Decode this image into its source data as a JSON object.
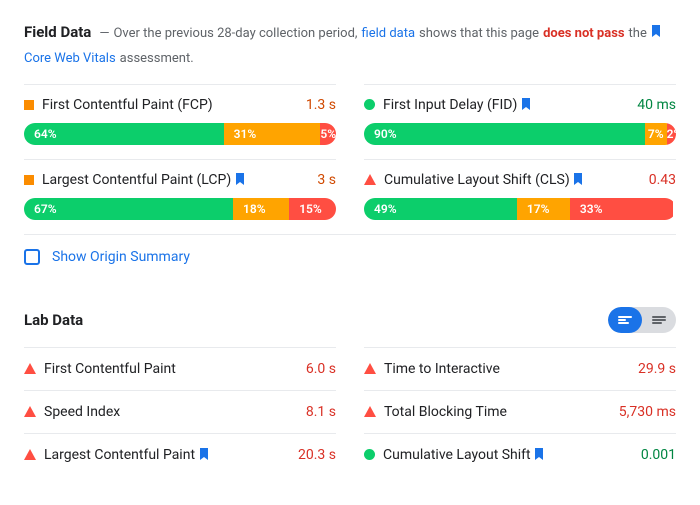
{
  "fieldData": {
    "title": "Field Data",
    "dash": "—",
    "desc_before": "Over the previous 28-day collection period,",
    "link_field_data": "field data",
    "desc_mid": "shows that this page",
    "fail_text": "does not pass",
    "desc_after": "the",
    "link_cwv": "Core Web Vitals",
    "desc_end": "assessment.",
    "metrics": [
      {
        "name": "First Contentful Paint (FCP)",
        "status": "square",
        "value": "1.3 s",
        "value_class": "val-orange",
        "bookmark": false,
        "dist": [
          64,
          31,
          5
        ]
      },
      {
        "name": "First Input Delay (FID)",
        "status": "circle",
        "value": "40 ms",
        "value_class": "val-green",
        "bookmark": true,
        "dist": [
          90,
          7,
          2
        ]
      },
      {
        "name": "Largest Contentful Paint (LCP)",
        "status": "square",
        "value": "3 s",
        "value_class": "val-orange",
        "bookmark": true,
        "dist": [
          67,
          18,
          15
        ]
      },
      {
        "name": "Cumulative Layout Shift (CLS)",
        "status": "triangle",
        "value": "0.43",
        "value_class": "val-red",
        "bookmark": true,
        "dist": [
          49,
          17,
          33
        ]
      }
    ],
    "origin_label": "Show Origin Summary"
  },
  "labData": {
    "title": "Lab Data",
    "metrics": [
      {
        "name": "First Contentful Paint",
        "status": "triangle",
        "value": "6.0 s",
        "value_class": "val-red",
        "bookmark": false
      },
      {
        "name": "Time to Interactive",
        "status": "triangle",
        "value": "29.9 s",
        "value_class": "val-red",
        "bookmark": false
      },
      {
        "name": "Speed Index",
        "status": "triangle",
        "value": "8.1 s",
        "value_class": "val-red",
        "bookmark": false
      },
      {
        "name": "Total Blocking Time",
        "status": "triangle",
        "value": "5,730 ms",
        "value_class": "val-red",
        "bookmark": false
      },
      {
        "name": "Largest Contentful Paint",
        "status": "triangle",
        "value": "20.3 s",
        "value_class": "val-red",
        "bookmark": true
      },
      {
        "name": "Cumulative Layout Shift",
        "status": "circle",
        "value": "0.001",
        "value_class": "val-green",
        "bookmark": true
      }
    ]
  }
}
